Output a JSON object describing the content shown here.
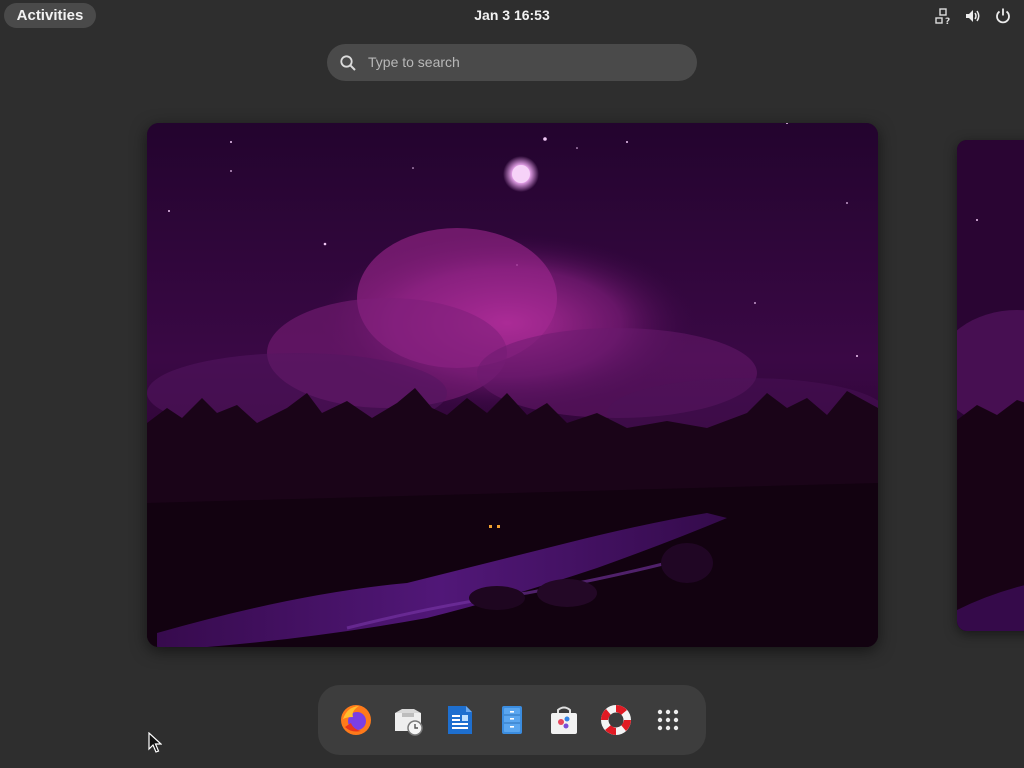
{
  "topbar": {
    "activities_label": "Activities",
    "clock": "Jan 3  16:53",
    "system_icons": [
      "network-offline-icon",
      "volume-icon",
      "power-icon"
    ]
  },
  "search": {
    "placeholder": "Type to search",
    "icon": "search-icon"
  },
  "workspaces": {
    "current_wallpaper": "night landscape with moon, pink clouds, forest and river",
    "colors": {
      "sky_top": "#2a0533",
      "cloud": "#9a2a8e",
      "forest": "#160313"
    }
  },
  "dash": {
    "apps": [
      {
        "name": "Firefox",
        "icon": "firefox-icon"
      },
      {
        "name": "Deja Dup Backups",
        "icon": "backup-icon"
      },
      {
        "name": "LibreOffice Writer",
        "icon": "writer-document-icon"
      },
      {
        "name": "Files",
        "icon": "file-cabinet-icon"
      },
      {
        "name": "Software",
        "icon": "software-store-icon"
      },
      {
        "name": "Help",
        "icon": "lifebuoy-icon"
      },
      {
        "name": "Show Applications",
        "icon": "app-grid-icon"
      }
    ]
  },
  "colors": {
    "background": "#2e2e2e",
    "panel_button": "#4a4a4a",
    "dash": "#3d3d3d"
  }
}
